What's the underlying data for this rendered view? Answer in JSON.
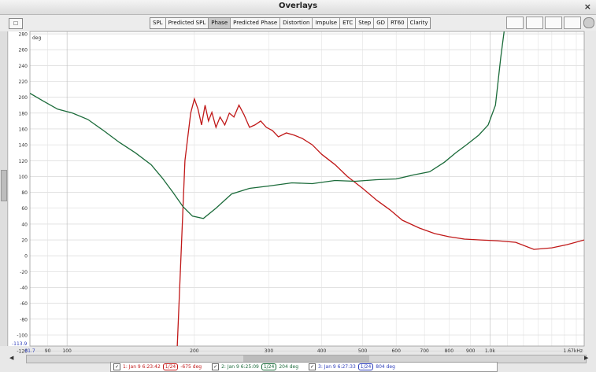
{
  "window": {
    "title": "Overlays",
    "close_label": "×"
  },
  "toolbar": {
    "left_button": "☐",
    "tabs": [
      "SPL",
      "Predicted SPL",
      "Phase",
      "Predicted Phase",
      "Distortion",
      "Impulse",
      "ETC",
      "Step",
      "GD",
      "RT60",
      "Clarity"
    ],
    "active_tab": "Phase"
  },
  "axes": {
    "y_unit": "deg",
    "y_ticks": [
      "280",
      "260",
      "240",
      "220",
      "200",
      "180",
      "160",
      "140",
      "120",
      "100",
      "80",
      "60",
      "40",
      "20",
      "0",
      "-20",
      "-40",
      "-60",
      "-80",
      "-100",
      "-120"
    ],
    "y_bottom_readout": "-113.9",
    "x_start_readout": "81.7",
    "x_ticks": [
      "90",
      "100",
      "200",
      "300",
      "400",
      "500",
      "600",
      "700",
      "800",
      "900",
      "1.0k"
    ],
    "x_end_label": "1.67kHz"
  },
  "chart_data": {
    "type": "line",
    "xlabel": "",
    "ylabel": "deg",
    "x_scale": "log",
    "xlim": [
      81.7,
      1670
    ],
    "ylim": [
      -113.9,
      283
    ],
    "series": [
      {
        "name": "1: Jan 9 6:23:42",
        "color": "#c01818",
        "x": [
          182,
          186,
          190,
          196,
          200,
          204,
          208,
          212,
          216,
          220,
          225,
          230,
          236,
          242,
          248,
          255,
          262,
          270,
          278,
          287,
          296,
          306,
          316,
          330,
          345,
          360,
          380,
          400,
          430,
          460,
          500,
          540,
          580,
          620,
          680,
          740,
          800,
          870,
          950,
          1040,
          1150,
          1270,
          1400,
          1520,
          1670
        ],
        "y": [
          -120,
          0,
          120,
          180,
          198,
          185,
          165,
          190,
          170,
          181,
          162,
          175,
          165,
          180,
          175,
          190,
          178,
          162,
          165,
          170,
          162,
          158,
          150,
          155,
          152,
          148,
          140,
          128,
          115,
          100,
          85,
          70,
          58,
          45,
          35,
          28,
          24,
          21,
          20,
          19,
          17,
          8,
          10,
          14,
          20
        ]
      },
      {
        "name": "2: Jan 9 6:25:09",
        "color": "#1b6b3a",
        "x": [
          81.7,
          88,
          95,
          103,
          112,
          122,
          133,
          145,
          158,
          168,
          178,
          188,
          198,
          210,
          225,
          245,
          270,
          300,
          340,
          380,
          430,
          480,
          540,
          600,
          660,
          720,
          780,
          830,
          880,
          940,
          990,
          1030,
          1060,
          1080
        ],
        "y": [
          205,
          195,
          185,
          180,
          172,
          158,
          143,
          130,
          115,
          98,
          80,
          62,
          50,
          47,
          60,
          78,
          85,
          88,
          92,
          91,
          95,
          94,
          96,
          97,
          102,
          106,
          118,
          130,
          140,
          152,
          165,
          190,
          250,
          283
        ]
      },
      {
        "name": "3: Jan 9 6:27:33",
        "color": "#2c3dba",
        "x": [],
        "y": []
      }
    ]
  },
  "legend": [
    {
      "check": "✓",
      "label": "1: Jan 9 6:23:42",
      "badge": "1/24",
      "value": "-675 deg",
      "color": "#c01818"
    },
    {
      "check": "✓",
      "label": "2: Jan 9 6:25:09",
      "badge": "1/24",
      "value": "204 deg",
      "color": "#1b6b3a"
    },
    {
      "check": "✓",
      "label": "3: Jan 9 6:27:33",
      "badge": "1/24",
      "value": "804 deg",
      "color": "#2c3dba"
    }
  ]
}
